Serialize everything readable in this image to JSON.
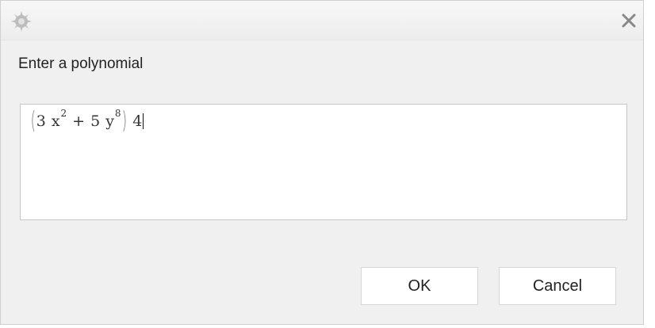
{
  "dialog": {
    "icon": "gear-icon",
    "close_icon": "close-icon",
    "prompt": "Enter a polynomial",
    "expression": {
      "coef1": "3",
      "var1": "x",
      "exp1": "2",
      "op": "+",
      "coef2": "5",
      "var2": "y",
      "exp2": "8",
      "tail": "4"
    },
    "ok_label": "OK",
    "cancel_label": "Cancel"
  },
  "colors": {
    "dialog_bg": "#f0f0f0",
    "titlebar_bg": "#ededed",
    "editor_bg": "#ffffff",
    "icon_gray": "#bdbdbd",
    "close_gray": "#888888"
  }
}
